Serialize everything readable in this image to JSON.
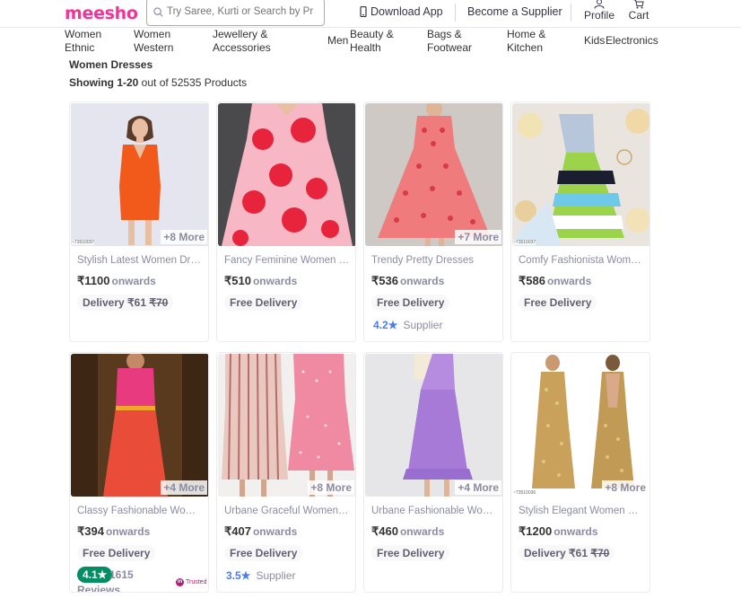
{
  "header": {
    "logo": "meesho",
    "search_placeholder": "Try Saree, Kurti or Search by Pr",
    "download_app": "Download App",
    "become_supplier": "Become a Supplier",
    "profile": "Profile",
    "cart": "Cart",
    "brand_color": "#f43397"
  },
  "categories": [
    {
      "l1": "Women",
      "l2": "Ethnic"
    },
    {
      "l1": "Women",
      "l2": "Western"
    },
    {
      "l1": "Jewellery &",
      "l2": "Accessories"
    },
    {
      "l1": "Men",
      "l2": ""
    },
    {
      "l1": "Beauty &",
      "l2": "Health"
    },
    {
      "l1": "Bags &",
      "l2": "Footwear"
    },
    {
      "l1": "Home &",
      "l2": "Kitchen"
    },
    {
      "l1": "Kids",
      "l2": ""
    },
    {
      "l1": "Electronics",
      "l2": ""
    }
  ],
  "listing": {
    "heading": "Women Dresses",
    "showing_bold": "Showing 1-20",
    "showing_rest": " out of 52535 Products"
  },
  "products": [
    {
      "title": "Stylish Latest Women Dresses",
      "price": "₹1100",
      "onwards": "onwards",
      "more": "+8 More",
      "delivery": "Delivery ₹61",
      "delivery_strike": "₹70",
      "tag": "~73510037"
    },
    {
      "title": "Fancy Feminine Women Dresses",
      "price": "₹510",
      "onwards": "onwards",
      "more": "",
      "delivery": "Free Delivery",
      "delivery_strike": ""
    },
    {
      "title": "Trendy Pretty Dresses",
      "price": "₹536",
      "onwards": "onwards",
      "more": "+7 More",
      "delivery": "Free Delivery",
      "delivery_strike": "",
      "rating": "4.2★",
      "rating_label": "Supplier"
    },
    {
      "title": "Comfy Fashionista Women Dresses",
      "price": "₹586",
      "onwards": "onwards",
      "more": "",
      "delivery": "Free Delivery",
      "delivery_strike": "",
      "tag": "~73510037"
    },
    {
      "title": "Classy Fashionable Women Dresses",
      "price": "₹394",
      "onwards": "onwards",
      "more": "+4 More",
      "delivery": "Free Delivery",
      "delivery_strike": "",
      "rating_badge": "4.1★",
      "review_count": "1615",
      "review_label": "Reviews",
      "trust": "Trusted"
    },
    {
      "title": "Urbane Graceful Women Dresses",
      "price": "₹407",
      "onwards": "onwards",
      "more": "+8 More",
      "delivery": "Free Delivery",
      "delivery_strike": "",
      "rating": "3.5★",
      "rating_label": "Supplier"
    },
    {
      "title": "Urbane Fashionable Women Dresses",
      "price": "₹460",
      "onwards": "onwards",
      "more": "+4 More",
      "delivery": "Free Delivery",
      "delivery_strike": ""
    },
    {
      "title": "Stylish Elegant Women Dresses",
      "price": "₹1200",
      "onwards": "onwards",
      "more": "+8 More",
      "delivery": "Delivery ₹61",
      "delivery_strike": "₹70",
      "tag": "~73510036"
    }
  ]
}
